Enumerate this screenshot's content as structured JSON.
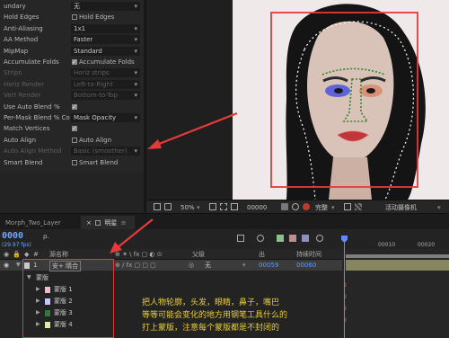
{
  "effects_panel": {
    "rows": [
      {
        "label": "undary",
        "kind": "select",
        "value": "无",
        "dim": false
      },
      {
        "label": "Hold Edges",
        "kind": "checkbox-left",
        "checked": false,
        "dim": false,
        "right_label": "Hold Edges"
      },
      {
        "label": "Anti-Aliasing",
        "kind": "select",
        "value": "1x1",
        "dim": false
      },
      {
        "label": "AA Method",
        "kind": "select",
        "value": "Faster",
        "dim": false
      },
      {
        "label": "MipMap",
        "kind": "select",
        "value": "Standard",
        "dim": false
      },
      {
        "label": "Accumulate Folds",
        "kind": "checkbox",
        "checked": true,
        "dim": false,
        "right_label": "Accumulate Folds"
      },
      {
        "label": "Strips",
        "kind": "select",
        "value": "Horiz strips",
        "dim": true
      },
      {
        "label": "Horiz Render",
        "kind": "select",
        "value": "Left-to-Right",
        "dim": true
      },
      {
        "label": "Vert Render",
        "kind": "select",
        "value": "Bottom-to-Top",
        "dim": true
      },
      {
        "label": "Use Auto Blend %",
        "kind": "checkbox",
        "checked": true,
        "dim": false,
        "right_label": ""
      },
      {
        "label": "Per-Mask Blend % Co",
        "kind": "select",
        "value": "Mask Opacity",
        "dim": false
      },
      {
        "label": "Match Vertices",
        "kind": "checkbox",
        "checked": true,
        "dim": false,
        "right_label": ""
      },
      {
        "label": "Auto Align",
        "kind": "checkbox",
        "checked": false,
        "dim": false,
        "right_label": "Auto Align"
      },
      {
        "label": "Auto Align Method",
        "kind": "select",
        "value": "Basic (smoother)",
        "dim": true
      },
      {
        "label": "Smart Blend",
        "kind": "checkbox",
        "checked": false,
        "dim": false,
        "right_label": "Smart Blend"
      }
    ]
  },
  "viewer_bar": {
    "zoom": "50%",
    "timecode": "00000",
    "resolution": "完整",
    "camera": "活动摄像机"
  },
  "tabs": {
    "tab1": "Morph_Two_Layer",
    "tab2": "明星"
  },
  "timeline": {
    "timecode": "0000",
    "fps": "(29.97 fps)",
    "search_placeholder": "ρ.",
    "ruler": [
      "00010",
      "00020"
    ],
    "columns": {
      "source_name": "源名称",
      "parent": "父级",
      "out": "出",
      "duration": "持续时间"
    },
    "layer": {
      "index": "1",
      "name": "安+ 晴合",
      "parent_value": "无",
      "out": "00059",
      "duration": "00060"
    },
    "mask_group": "蒙版",
    "masks": [
      {
        "name": "蒙版 1",
        "color": "#f0b8d0"
      },
      {
        "name": "蒙版 2",
        "color": "#c4c8ff"
      },
      {
        "name": "蒙版 3",
        "color": "#2c7b3c"
      },
      {
        "name": "蒙版 4",
        "color": "#e6e6a6"
      }
    ],
    "note_lines": [
      "把人物轮廓，头发，眼睛，鼻子，嘴巴",
      "等等可能会变化的地方用钢笔工具什么的",
      "打上蒙版，注意每个蒙版都是不封闭的"
    ]
  },
  "colors": {
    "accent_blue": "#6ea8ff",
    "annotation_red": "#e53a3a",
    "note_yellow": "#e6cd3a"
  }
}
